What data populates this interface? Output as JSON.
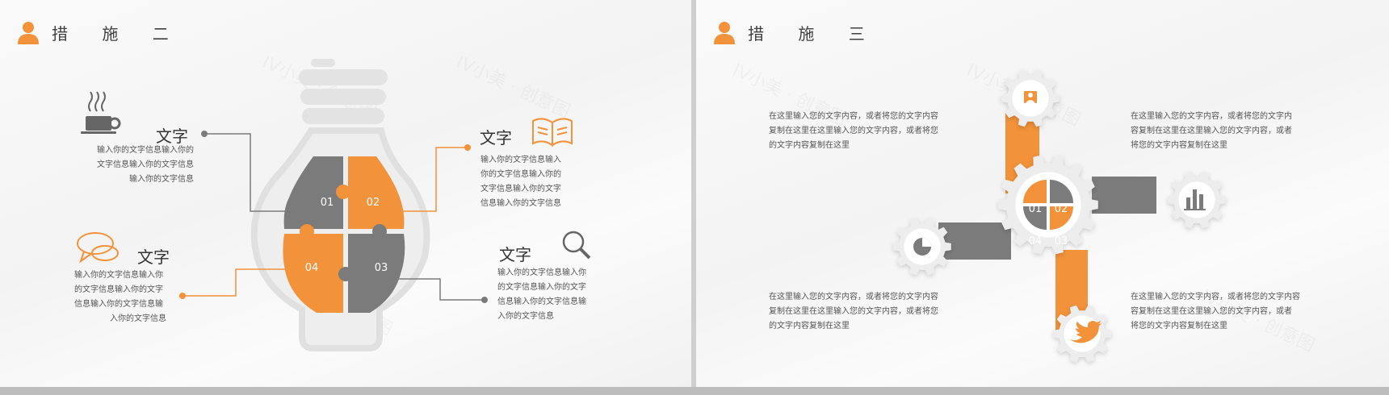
{
  "left": {
    "title": "措 施 二",
    "items": [
      {
        "label": "文字",
        "text": [
          "输入你的文字信息输入你的",
          "文字信息输入你的文字信息",
          "输入你的文字信息"
        ]
      },
      {
        "label": "文字",
        "text": [
          "输入你的文字信息输入",
          "你的文字信息输入你的",
          "文字信息输入你的文字",
          "信息输入你的文字信息"
        ]
      },
      {
        "label": "文字",
        "text": [
          "输入你的文字信息输入你",
          "的文字信息输入你的文字",
          "信息输入你的文字信息输",
          "入你的文字信息"
        ]
      },
      {
        "label": "文字",
        "text": [
          "输入你的文字信息输入你",
          "的文字信息输入你的文字",
          "信息输入你的文字信息输",
          "入你的文字信息"
        ]
      }
    ],
    "pieces": [
      "01",
      "02",
      "04",
      "03"
    ]
  },
  "right": {
    "title": "措 施 三",
    "texts": [
      [
        "在这里输入您的文字内容，或者将您的文字内容",
        "复制在这里在这里输入您的文字内容，或者将您",
        "的文字内容复制在这里"
      ],
      [
        "在这里输入您的文字内容，或者将您的文字内",
        "容复制在这里在这里输入您的文字内容，或者",
        "将您的文字内容复制在这里"
      ],
      [
        "在这里输入您的文字内容，或者将您的文字内容",
        "复制在这里在这里输入您的文字内容，或者将您",
        "的文字内容复制在这里"
      ],
      [
        "在这里输入您的文字内容，或者将您的文字内容",
        "容复制在这里在这里输入您的文字内容，或者",
        "将您的文字内容复制在这里"
      ]
    ],
    "segments": [
      "01",
      "02",
      "04",
      "03"
    ]
  },
  "colors": {
    "accent": "#f2923a",
    "gray": "#7b7b7b",
    "light": "#e3e3e3"
  },
  "icons": [
    "user-icon",
    "coffee-icon",
    "book-icon",
    "chat-icon",
    "search-icon",
    "pie-chart-icon",
    "bar-chart-icon",
    "twitter-bird-icon"
  ]
}
